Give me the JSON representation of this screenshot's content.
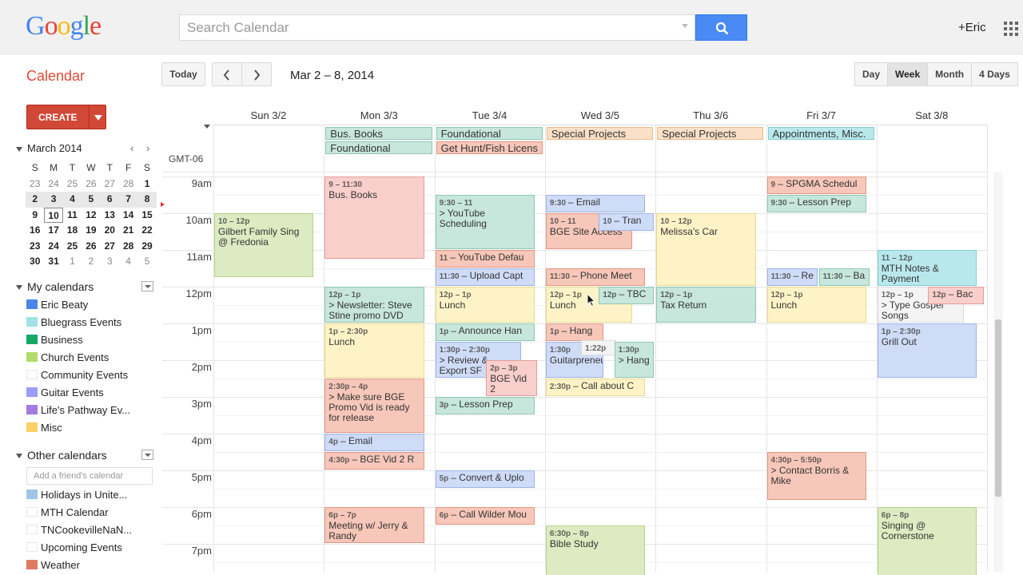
{
  "header": {
    "logo": "Google",
    "search_placeholder": "Search Calendar",
    "user": "+Eric"
  },
  "toolbar": {
    "app_title": "Calendar",
    "today": "Today",
    "date_range": "Mar 2 – 8, 2014",
    "views": [
      "Day",
      "Week",
      "Month",
      "4 Days"
    ],
    "active_view": "Week"
  },
  "sidebar": {
    "create": "CREATE",
    "mini_month": "March 2014",
    "mini_dow": [
      "S",
      "M",
      "T",
      "W",
      "T",
      "F",
      "S"
    ],
    "mini_weeks": [
      [
        "23",
        "24",
        "25",
        "26",
        "27",
        "28",
        "1"
      ],
      [
        "2",
        "3",
        "4",
        "5",
        "6",
        "7",
        "8"
      ],
      [
        "9",
        "10",
        "11",
        "12",
        "13",
        "14",
        "15"
      ],
      [
        "16",
        "17",
        "18",
        "19",
        "20",
        "21",
        "22"
      ],
      [
        "23",
        "24",
        "25",
        "26",
        "27",
        "28",
        "29"
      ],
      [
        "30",
        "31",
        "1",
        "2",
        "3",
        "4",
        "5"
      ]
    ],
    "my_calendars_title": "My calendars",
    "my_calendars": [
      {
        "name": "Eric Beaty",
        "color": "#4a86e8"
      },
      {
        "name": "Bluegrass Events",
        "color": "#9fe1e7"
      },
      {
        "name": "Business",
        "color": "#16a765"
      },
      {
        "name": "Church Events",
        "color": "#b3dc6c"
      },
      {
        "name": "Community Events",
        "color": "#ffffff"
      },
      {
        "name": "Guitar Events",
        "color": "#9a9cff"
      },
      {
        "name": "Life's Pathway Ev...",
        "color": "#a479e2"
      },
      {
        "name": "Misc",
        "color": "#fad165"
      }
    ],
    "other_calendars_title": "Other calendars",
    "friend_placeholder": "Add a friend's calendar",
    "other_calendars": [
      {
        "name": "Holidays in Unite...",
        "color": "#9fc6e7"
      },
      {
        "name": "MTH Calendar",
        "color": "#ffffff"
      },
      {
        "name": "TNCookevilleNaN...",
        "color": "#ffffff"
      },
      {
        "name": "Upcoming Events",
        "color": "#ffffff"
      },
      {
        "name": "Weather",
        "color": "#e07b60"
      }
    ]
  },
  "grid": {
    "timezone": "GMT-06",
    "days": [
      "Sun 3/2",
      "Mon 3/3",
      "Tue 3/4",
      "Wed 3/5",
      "Thu 3/6",
      "Fri 3/7",
      "Sat 3/8"
    ],
    "hours": [
      "9am",
      "10am",
      "11am",
      "12pm",
      "1pm",
      "2pm",
      "3pm",
      "4pm",
      "5pm",
      "6pm",
      "7pm"
    ],
    "allday": [
      {
        "day": 1,
        "row": 0,
        "title": "Bus. Books",
        "color": "green"
      },
      {
        "day": 1,
        "row": 1,
        "title": "Foundational",
        "color": "green"
      },
      {
        "day": 2,
        "row": 0,
        "title": "Foundational",
        "color": "green"
      },
      {
        "day": 2,
        "row": 1,
        "title": "Get Hunt/Fish Licens",
        "color": "salmon"
      },
      {
        "day": 3,
        "row": 0,
        "title": "Special Projects",
        "color": "orange"
      },
      {
        "day": 4,
        "row": 0,
        "title": "Special Projects",
        "color": "orange"
      },
      {
        "day": 5,
        "row": 0,
        "title": "Appointments, Misc.",
        "color": "teal"
      }
    ],
    "events": [
      {
        "day": 0,
        "start": 10,
        "end": 11.75,
        "col": 0,
        "cols": 1,
        "time": "10 – 12p",
        "title": "Gilbert Family Sing @ Fredonia",
        "color": "lime"
      },
      {
        "day": 1,
        "start": 9,
        "end": 11.25,
        "col": 0,
        "cols": 1,
        "time": "9 – 11:30",
        "title": "Bus. Books",
        "color": "pink"
      },
      {
        "day": 1,
        "start": 12,
        "end": 13,
        "col": 0,
        "cols": 1,
        "time": "12p – 1p",
        "title": "> Newsletter: Steve Stine promo DVD",
        "color": "green"
      },
      {
        "day": 1,
        "start": 13,
        "end": 14.5,
        "col": 0,
        "cols": 1,
        "time": "1p – 2:30p",
        "title": "Lunch",
        "color": "yellow"
      },
      {
        "day": 1,
        "start": 14.5,
        "end": 16,
        "col": 0,
        "cols": 1,
        "time": "2:30p – 4p",
        "title": "> Make sure BGE Promo Vid is ready for release",
        "color": "salmon"
      },
      {
        "day": 1,
        "start": 16,
        "end": 16.5,
        "col": 0,
        "cols": 1,
        "time": "4p",
        "title": "– Email",
        "color": "blue",
        "one": true
      },
      {
        "day": 1,
        "start": 16.5,
        "end": 17,
        "col": 0,
        "cols": 1,
        "time": "4:30p",
        "title": "– BGE Vid 2 R",
        "color": "salmon",
        "one": true
      },
      {
        "day": 1,
        "start": 18,
        "end": 19,
        "col": 0,
        "cols": 1,
        "time": "6p – 7p",
        "title": "Meeting w/ Jerry & Randy",
        "color": "salmon"
      },
      {
        "day": 2,
        "start": 9.5,
        "end": 11,
        "col": 0,
        "cols": 1,
        "time": "9:30 – 11",
        "title": "> YouTube Scheduling",
        "color": "green"
      },
      {
        "day": 2,
        "start": 11,
        "end": 11.5,
        "col": 0,
        "cols": 1,
        "time": "11",
        "title": "– YouTube Defau",
        "color": "salmon",
        "one": true
      },
      {
        "day": 2,
        "start": 11.5,
        "end": 12,
        "col": 0,
        "cols": 1,
        "time": "11:30",
        "title": "– Upload Capt",
        "color": "blue",
        "one": true
      },
      {
        "day": 2,
        "start": 12,
        "end": 13,
        "col": 0,
        "cols": 1,
        "time": "12p – 1p",
        "title": "Lunch",
        "color": "yellow"
      },
      {
        "day": 2,
        "start": 13,
        "end": 13.5,
        "col": 0,
        "cols": 1,
        "time": "1p",
        "title": "– Announce Han",
        "color": "green",
        "one": true
      },
      {
        "day": 2,
        "start": 13.5,
        "end": 14.5,
        "col": 0,
        "cols": 1,
        "time": "1:30p – 2:30p",
        "title": "> Review & Export SF",
        "color": "blue",
        "w": 0.78
      },
      {
        "day": 2,
        "start": 14,
        "end": 15,
        "col": 1,
        "cols": 2,
        "time": "2p – 3p",
        "title": "BGE Vid 2",
        "color": "pink",
        "xoff": 0.46,
        "w": 0.46
      },
      {
        "day": 2,
        "start": 15,
        "end": 15.5,
        "col": 0,
        "cols": 1,
        "time": "3p",
        "title": "– Lesson Prep",
        "color": "green",
        "one": true
      },
      {
        "day": 2,
        "start": 17,
        "end": 17.5,
        "col": 0,
        "cols": 1,
        "time": "5p",
        "title": "– Convert & Uplo",
        "color": "blue",
        "one": true
      },
      {
        "day": 2,
        "start": 18,
        "end": 18.5,
        "col": 0,
        "cols": 1,
        "time": "6p",
        "title": "– Call Wilder Mou",
        "color": "salmon",
        "one": true
      },
      {
        "day": 3,
        "start": 9.5,
        "end": 10,
        "col": 0,
        "cols": 1,
        "time": "9:30",
        "title": "– Email",
        "color": "blue",
        "one": true
      },
      {
        "day": 3,
        "start": 10,
        "end": 11,
        "col": 0,
        "cols": 1,
        "time": "10 – 11",
        "title": "BGE Site Access",
        "color": "salmon",
        "w": 0.78
      },
      {
        "day": 3,
        "start": 10,
        "end": 10.5,
        "col": 1,
        "cols": 2,
        "time": "10",
        "title": "– Tran",
        "color": "blue",
        "xoff": 0.48,
        "w": 0.5,
        "one": true
      },
      {
        "day": 3,
        "start": 11.5,
        "end": 12,
        "col": 0,
        "cols": 1,
        "time": "11:30",
        "title": "– Phone Meet",
        "color": "salmon",
        "one": true
      },
      {
        "day": 3,
        "start": 12,
        "end": 13,
        "col": 0,
        "cols": 1,
        "time": "12p – 1p",
        "title": "Lunch",
        "color": "yellow",
        "w": 0.78
      },
      {
        "day": 3,
        "start": 12,
        "end": 12.5,
        "col": 1,
        "cols": 2,
        "time": "12p",
        "title": "– TBC",
        "color": "green",
        "xoff": 0.48,
        "w": 0.5,
        "one": true
      },
      {
        "day": 3,
        "start": 13,
        "end": 13.5,
        "col": 0,
        "cols": 1,
        "time": "1p",
        "title": "– Hang",
        "color": "salmon",
        "w": 0.52,
        "one": true
      },
      {
        "day": 3,
        "start": 13.5,
        "end": 14.5,
        "col": 0,
        "cols": 1,
        "time": "1:30p",
        "title": "Guitarpreneur",
        "color": "blue",
        "w": 0.52
      },
      {
        "day": 3,
        "start": 13.45,
        "end": 13.9,
        "col": 1,
        "cols": 3,
        "time": "1:22p",
        "title": "",
        "color": "white",
        "xoff": 0.32,
        "w": 0.32,
        "one": true
      },
      {
        "day": 3,
        "start": 13.5,
        "end": 14.5,
        "col": 2,
        "cols": 3,
        "time": "1:30p",
        "title": "> Hang",
        "color": "green",
        "xoff": 0.62,
        "w": 0.36
      },
      {
        "day": 3,
        "start": 14.5,
        "end": 15,
        "col": 0,
        "cols": 1,
        "time": "2:30p",
        "title": "– Call about C",
        "color": "yellow",
        "one": true
      },
      {
        "day": 3,
        "start": 18.5,
        "end": 20,
        "col": 0,
        "cols": 1,
        "time": "6:30p – 8p",
        "title": "Bible Study",
        "color": "lime"
      },
      {
        "day": 4,
        "start": 10,
        "end": 12,
        "col": 0,
        "cols": 1,
        "time": "10 – 12p",
        "title": "Melissa's Car",
        "color": "yellow"
      },
      {
        "day": 4,
        "start": 12,
        "end": 13,
        "col": 0,
        "cols": 1,
        "time": "12p – 1p",
        "title": "Tax Return",
        "color": "green"
      },
      {
        "day": 5,
        "start": 9,
        "end": 9.5,
        "col": 0,
        "cols": 1,
        "time": "9",
        "title": "– SPGMA Schedul",
        "color": "salmon",
        "one": true
      },
      {
        "day": 5,
        "start": 9.5,
        "end": 10,
        "col": 0,
        "cols": 1,
        "time": "9:30",
        "title": "– Lesson Prep",
        "color": "green",
        "one": true
      },
      {
        "day": 5,
        "start": 11.5,
        "end": 12,
        "col": 0,
        "cols": 2,
        "time": "11:30",
        "title": "– Re",
        "color": "blue",
        "w": 0.46,
        "one": true
      },
      {
        "day": 5,
        "start": 11.5,
        "end": 12,
        "col": 1,
        "cols": 2,
        "time": "11:30",
        "title": "– Ba",
        "color": "green",
        "xoff": 0.47,
        "w": 0.46,
        "one": true
      },
      {
        "day": 5,
        "start": 12,
        "end": 13,
        "col": 0,
        "cols": 1,
        "time": "12p – 1p",
        "title": "Lunch",
        "color": "yellow"
      },
      {
        "day": 5,
        "start": 16.5,
        "end": 17.83,
        "col": 0,
        "cols": 1,
        "time": "4:30p – 5:50p",
        "title": "> Contact Borris & Mike",
        "color": "salmon"
      },
      {
        "day": 6,
        "start": 11,
        "end": 12,
        "col": 0,
        "cols": 1,
        "time": "11 – 12p",
        "title": "MTH Notes & Payment",
        "color": "teal"
      },
      {
        "day": 6,
        "start": 12,
        "end": 13,
        "col": 0,
        "cols": 1,
        "time": "12p – 1p",
        "title": "> Type Gospel Songs",
        "color": "white",
        "w": 0.78
      },
      {
        "day": 6,
        "start": 12,
        "end": 12.5,
        "col": 1,
        "cols": 2,
        "time": "12p",
        "title": "– Bac",
        "color": "pink",
        "xoff": 0.46,
        "w": 0.5,
        "one": true
      },
      {
        "day": 6,
        "start": 13,
        "end": 14.5,
        "col": 0,
        "cols": 1,
        "time": "1p – 2:30p",
        "title": "Grill Out",
        "color": "blue"
      },
      {
        "day": 6,
        "start": 18,
        "end": 20,
        "col": 0,
        "cols": 1,
        "time": "6p – 8p",
        "title": "Singing @ Cornerstone",
        "color": "lime"
      }
    ]
  }
}
